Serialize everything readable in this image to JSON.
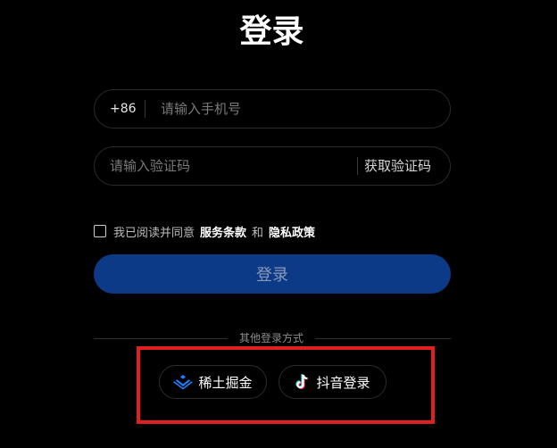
{
  "page": {
    "title": "登录"
  },
  "phone": {
    "prefix": "+86",
    "placeholder": "请输入手机号"
  },
  "code": {
    "placeholder": "请输入验证码",
    "get_code_label": "获取验证码"
  },
  "agreement": {
    "text": "我已阅读并同意",
    "terms_label": "服务条款",
    "and": "和",
    "privacy_label": "隐私政策"
  },
  "login_button": {
    "label": "登录"
  },
  "other_login": {
    "label": "其他登录方式",
    "providers": [
      {
        "label": "稀土掘金",
        "icon": "juejin-icon"
      },
      {
        "label": "抖音登录",
        "icon": "douyin-icon"
      }
    ]
  },
  "colors": {
    "background": "#000000",
    "login_button": "#0d3a87",
    "highlight_border": "#e02020",
    "juejin_brand": "#1e80ff"
  }
}
